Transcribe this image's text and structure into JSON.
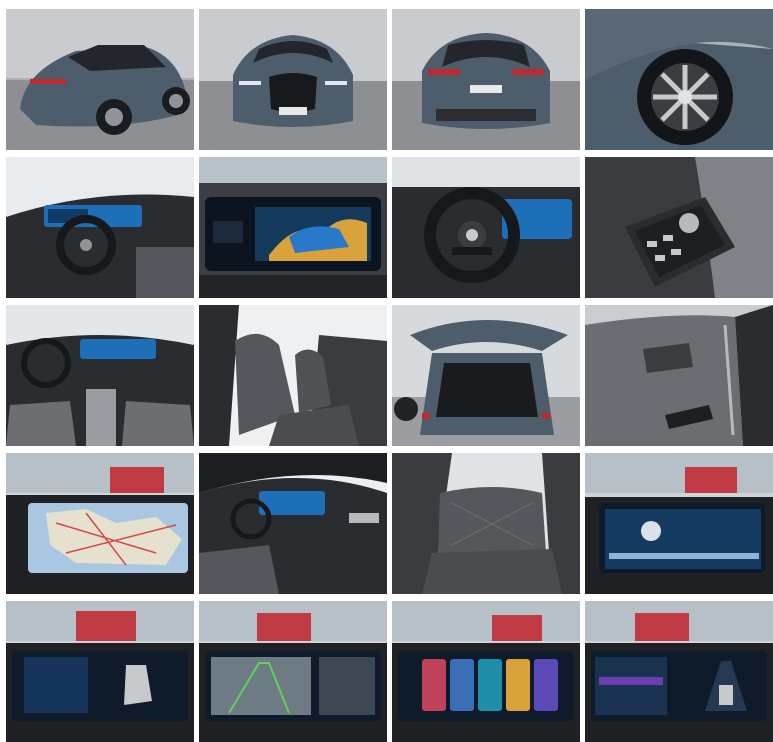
{
  "gallery": {
    "columns": 4,
    "rows": 5,
    "photos": [
      {
        "id": "car-rear-three-quarter"
      },
      {
        "id": "car-front"
      },
      {
        "id": "car-rear"
      },
      {
        "id": "car-wheel"
      },
      {
        "id": "interior-dashboard-wide"
      },
      {
        "id": "instrument-display"
      },
      {
        "id": "steering-wheel"
      },
      {
        "id": "center-console-controls"
      },
      {
        "id": "interior-front-seats"
      },
      {
        "id": "front-seat-side"
      },
      {
        "id": "open-trunk"
      },
      {
        "id": "door-panel"
      },
      {
        "id": "navigation-screen"
      },
      {
        "id": "dashboard-passenger-side"
      },
      {
        "id": "rear-seats"
      },
      {
        "id": "infotainment-menu"
      },
      {
        "id": "screen-seat-settings"
      },
      {
        "id": "screen-camera-view"
      },
      {
        "id": "screen-app-widgets"
      },
      {
        "id": "screen-driver-assistance"
      }
    ]
  },
  "colors": {
    "car_paint": "#4e5d6c",
    "showroom_wall": "#c9cbce",
    "showroom_floor": "#8d8f92",
    "cabin_dark": "#2a2c30",
    "seat_leather": "#55575c",
    "screen_blue": "#1d6fb8"
  }
}
